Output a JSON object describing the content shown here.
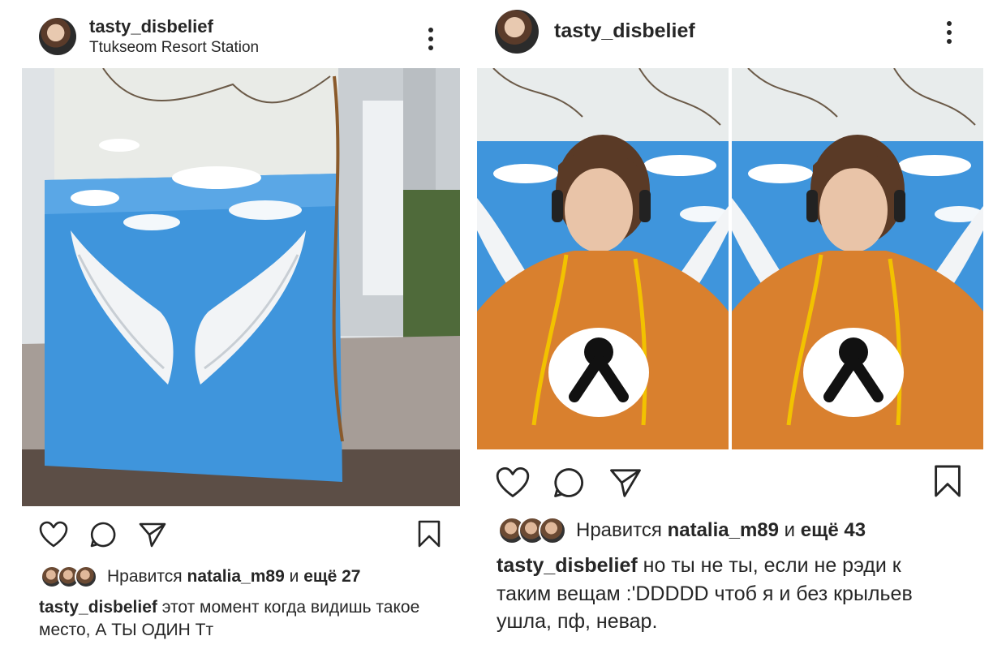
{
  "left_post": {
    "username": "tasty_disbelief",
    "location": "Ttukseom Resort Station",
    "likes": {
      "prefix": "Нравится",
      "liker": "natalia_m89",
      "connector": "и",
      "others": "ещё 27"
    },
    "caption": {
      "username": "tasty_disbelief",
      "text": "этот момент когда видишь такое место, А ТЫ ОДИН Тт"
    }
  },
  "right_post": {
    "username": "tasty_disbelief",
    "likes": {
      "prefix": "Нравится",
      "liker": "natalia_m89",
      "connector": "и",
      "others": "ещё 43"
    },
    "caption": {
      "username": "tasty_disbelief",
      "text": "но ты не ты, если не рэди к таким вещам :'DDDDD чтоб я и без крыльев ушла, пф, невар."
    }
  },
  "icons": {
    "like": "heart-icon",
    "comment": "comment-icon",
    "share": "send-icon",
    "save": "bookmark-icon",
    "more": "more-vertical-icon"
  },
  "colors": {
    "text": "#262626",
    "sky": "#3f95dc",
    "hoodie": "#d9802e"
  }
}
